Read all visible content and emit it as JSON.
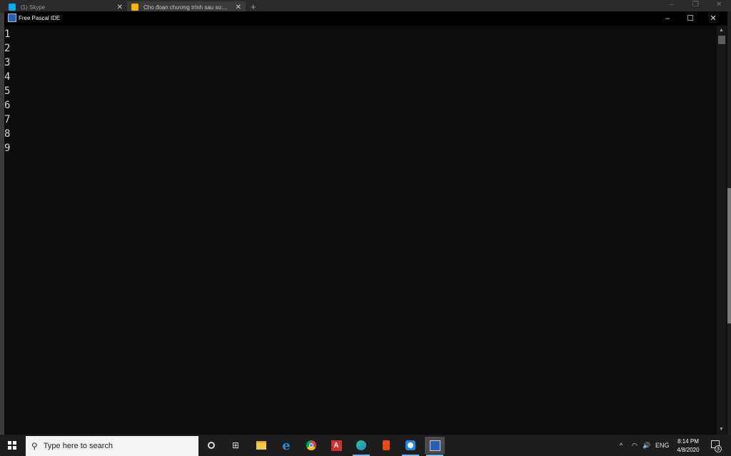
{
  "browser": {
    "tabs": [
      {
        "label": "(1) Skype",
        "close": "✕"
      },
      {
        "label": "Cho đoạn chương trình sau so:...",
        "close": "✕"
      }
    ],
    "new_tab": "+",
    "controls": {
      "minimize": "–",
      "restore": "❐",
      "close": "✕"
    }
  },
  "window": {
    "title": "Free Pascal IDE",
    "controls": {
      "minimize": "–",
      "maximize": "☐",
      "close": "✕"
    }
  },
  "editor": {
    "line_numbers": [
      "1",
      "2",
      "3",
      "4",
      "5",
      "6",
      "7",
      "8",
      "9"
    ]
  },
  "scrollbar": {
    "up": "▲",
    "down": "▼"
  },
  "taskbar": {
    "search_placeholder": "Type here to search",
    "search_icon": "search-icon",
    "apps": [
      "cortana-icon",
      "task-view-icon",
      "file-explorer-icon",
      "internet-explorer-icon",
      "chrome-icon",
      "acrobat-icon",
      "edge-icon",
      "office-icon",
      "blue-app-icon",
      "free-pascal-icon"
    ],
    "task_view_glyph": "⊞",
    "ie_glyph": "e",
    "acrobat_glyph": "A",
    "tray": {
      "chevron": "^",
      "wifi": "◠",
      "volume": "🔊",
      "language": "ENG",
      "time": "8:14 PM",
      "date": "4/8/2020",
      "notifications": "3"
    }
  }
}
